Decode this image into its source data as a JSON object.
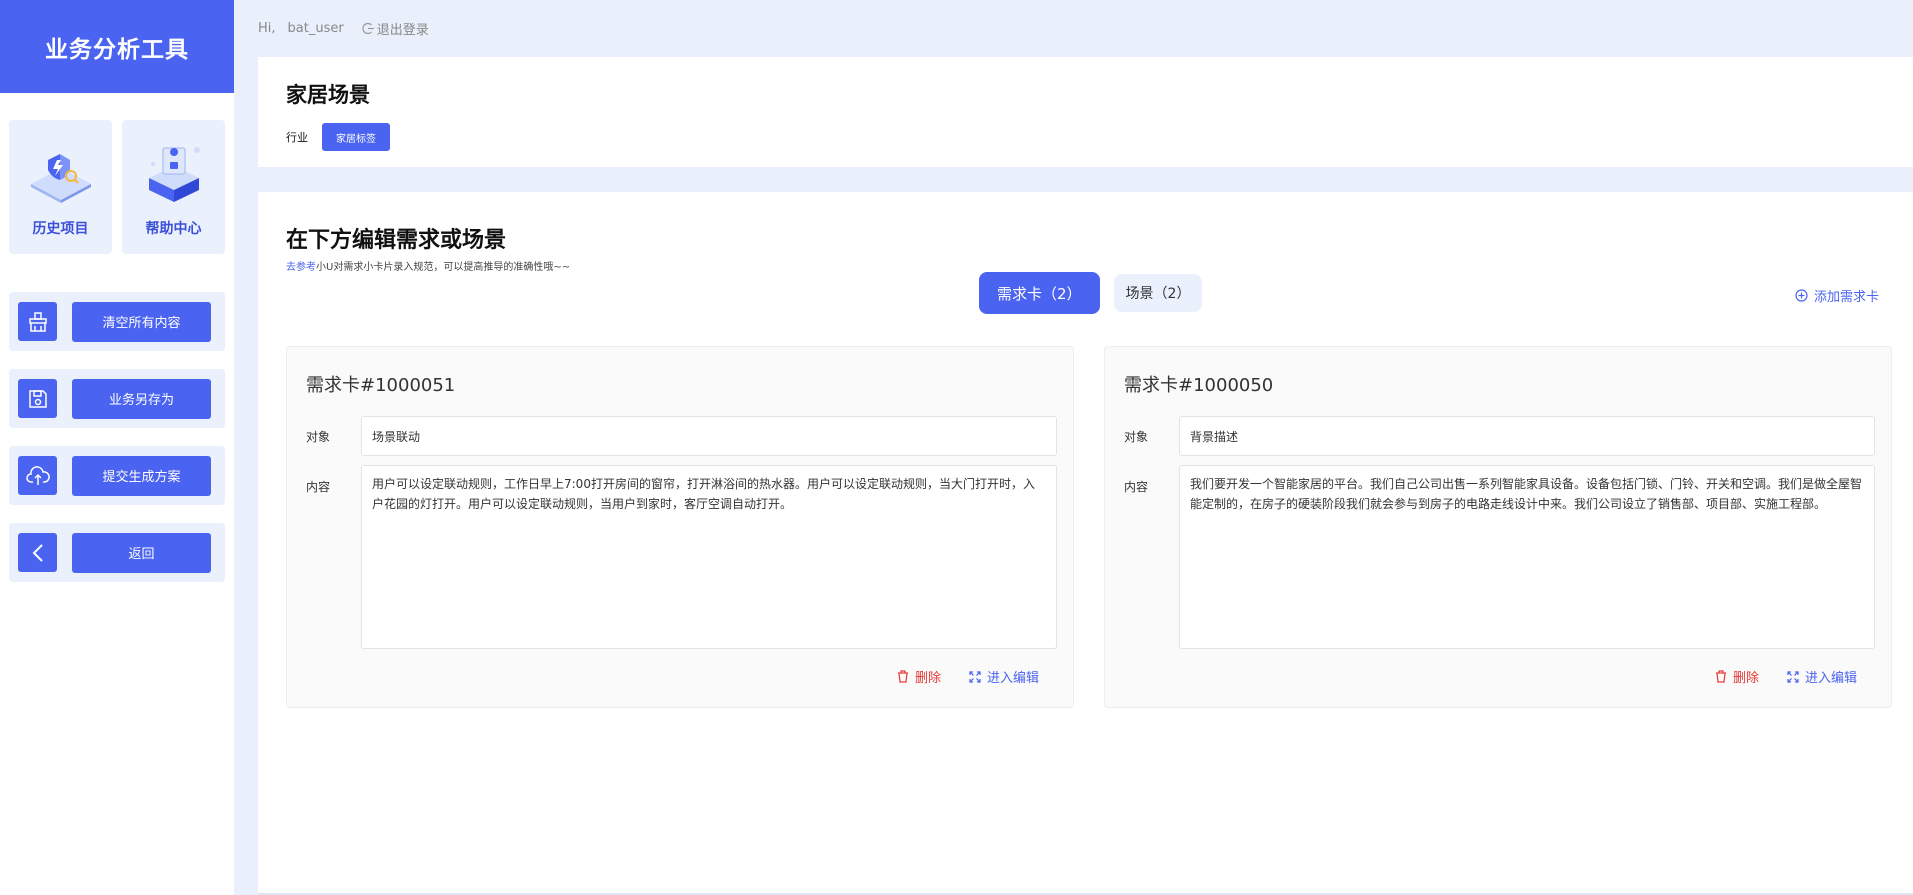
{
  "app": {
    "title": "业务分析工具"
  },
  "sidebar": {
    "tiles": [
      {
        "label": "历史项目",
        "icon": "history-shield-icon"
      },
      {
        "label": "帮助中心",
        "icon": "help-box-icon"
      }
    ],
    "actions": [
      {
        "label": "清空所有内容",
        "icon": "broom-icon"
      },
      {
        "label": "业务另存为",
        "icon": "save-icon"
      },
      {
        "label": "提交生成方案",
        "icon": "upload-cloud-icon"
      },
      {
        "label": "返回",
        "icon": "chevron-left-icon"
      }
    ]
  },
  "topbar": {
    "greeting": "Hi,",
    "username": "bat_user",
    "logout": "退出登录"
  },
  "header": {
    "title": "家居场景",
    "industry_label": "行业",
    "industry_tag": "家居标签"
  },
  "editor": {
    "title": "在下方编辑需求或场景",
    "hint_link": "去参考",
    "hint_text": "小U对需求小卡片录入规范，可以提高推导的准确性哦~~",
    "tabs": [
      {
        "label": "需求卡（2）",
        "active": true
      },
      {
        "label": "场景（2）",
        "active": false
      }
    ],
    "add_card": "添加需求卡"
  },
  "cards": [
    {
      "title": "需求卡#1000051",
      "object_label": "对象",
      "object_value": "场景联动",
      "content_label": "内容",
      "content_value": "用户可以设定联动规则，工作日早上7:00打开房间的窗帘，打开淋浴间的热水器。用户可以设定联动规则，当大门打开时，入户花园的灯打开。用户可以设定联动规则，当用户到家时，客厅空调自动打开。",
      "delete": "删除",
      "edit": "进入编辑"
    },
    {
      "title": "需求卡#1000050",
      "object_label": "对象",
      "object_value": "背景描述",
      "content_label": "内容",
      "content_value": "我们要开发一个智能家居的平台。我们自己公司出售一系列智能家具设备。设备包括门锁、门铃、开关和空调。我们是做全屋智能定制的，在房子的硬装阶段我们就会参与到房子的电路走线设计中来。我们公司设立了销售部、项目部、实施工程部。",
      "delete": "删除",
      "edit": "进入编辑"
    }
  ],
  "colors": {
    "accent": "#4a63f0",
    "tile_bg": "#eaf0fc",
    "delete": "#e53935",
    "page_bg": "#e9f0fb"
  }
}
